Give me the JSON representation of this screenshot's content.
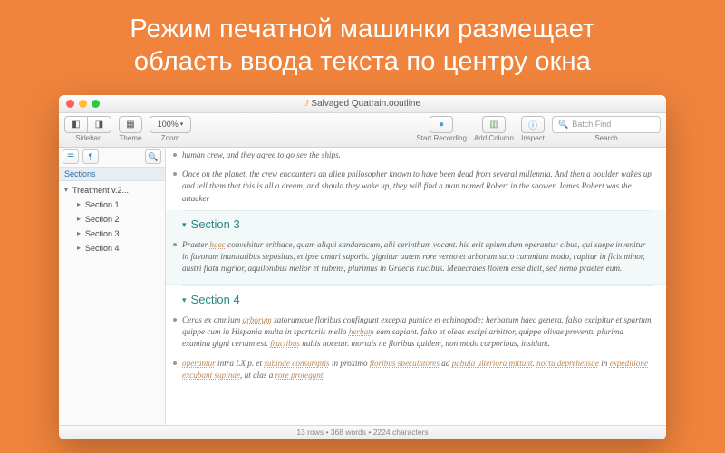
{
  "hero": {
    "line1": "Режим печатной машинки размещает",
    "line2": "область ввода текста по центру окна"
  },
  "window": {
    "title": "Salvaged Quatrain.ooutline"
  },
  "toolbar": {
    "sidebar_label": "Sidebar",
    "theme_label": "Theme",
    "zoom_label": "Zoom",
    "zoom_value": "100%",
    "start_recording_label": "Start Recording",
    "add_column_label": "Add Column",
    "inspect_label": "Inspect",
    "search_label": "Search",
    "search_placeholder": "Batch Find"
  },
  "sidebar": {
    "sections_hdr": "Sections",
    "root": "Treatment v.2...",
    "items": [
      "Section 1",
      "Section 2",
      "Section 3",
      "Section 4"
    ]
  },
  "content": {
    "p0": "human crew, and they agree to go see the ships.",
    "p1": "Once on the planet, the crew encounters an alien philosopher known to have been dead from several millennia. And then a boulder wakes up and tell them that this is all a dream, and should they wake up, they will find a man named Robert in the shower. James Robert was the attacker",
    "s3": "Section 3",
    "p2a": "Praeter ",
    "p2u1": "haec",
    "p2b": " convehitur erithace, quam aliqui sandaracam, alii cerinthum vocant. hic erit apium dum operantur cibus, qui saepe invenitur in favorum inanitatibus sepositus, et ipse amari saporis. gignitur autem rore verno et arborum suco cummium modo, capitur in ficis minor, austri flatu nigrior, aquilonibus melior et rubens, plurimus in Graecis nucibus. Menecrates florem esse dicit, sed nemo praeter eum.",
    "s4": "Section 4",
    "p3a": "Ceras ex omnium ",
    "p3u1": "arborum",
    "p3b": " satorumque floribus confingunt excepta pumice et echinopode; herbarum haec genera. falso excipitur et spartum, quippe cum in Hispania multa in spartariis mella ",
    "p3u2": "herbam",
    "p3c": " eam sapiant. falso et oleas excipi arbitror, quippe olivae proventu plurima examina gigni certum est. ",
    "p3u3": "fructibus",
    "p3d": " nullis nocetur. mortuis ne floribus quidem, non modo corporibus, insidunt.",
    "p4a": "operantur",
    "p4b": " intra LX p. et ",
    "p4u1": "subinde consumptis",
    "p4c": " in proximo ",
    "p4u2": "floribus speculatores",
    "p4d": " ad ",
    "p4u3": "pabula ulteriora mittunt",
    "p4e": ". ",
    "p4u4": "noctu deprehensae",
    "p4f": " in ",
    "p4u5": "expeditione excubant supinae",
    "p4g": ", ut alas a ",
    "p4u6": "rore protegant",
    "p4h": "."
  },
  "status": {
    "text": "13 rows • 368 words • 2224 characters"
  }
}
